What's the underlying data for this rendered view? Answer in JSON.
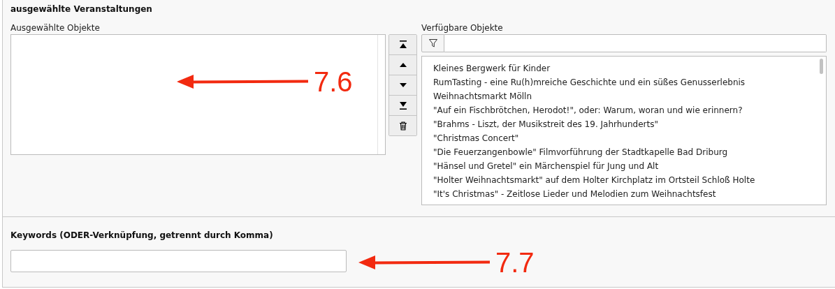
{
  "section_title": "ausgewählte Veranstaltungen",
  "selected_objects": {
    "label": "Ausgewählte Objekte"
  },
  "available_objects": {
    "label": "Verfügbare Objekte",
    "items": [
      "Kleines Bergwerk für Kinder",
      "RumTasting - eine Ru(h)mreiche Geschichte und ein süßes Genusserlebnis",
      "Weihnachtsmarkt Mölln",
      "\"Auf ein Fischbrötchen, Herodot!\", oder: Warum, woran und wie erinnern?",
      "\"Brahms - Liszt, der Musikstreit des 19. Jahrhunderts\"",
      "\"Christmas Concert\"",
      "\"Die Feuerzangenbowle\" Filmvorführung der Stadtkapelle Bad Driburg",
      "\"Hänsel und Gretel\" ein Märchenspiel für Jung und Alt",
      "\"Holter Weihnachtsmarkt\" auf dem Holter Kirchplatz im Ortsteil Schloß Holte",
      "\"It's Christmas\" - Zeitlose Lieder und Melodien zum Weihnachtsfest"
    ]
  },
  "keywords": {
    "label": "Keywords (ODER-Verknüpfung, getrennt durch Komma)"
  },
  "annotations": [
    {
      "label": "7.6"
    },
    {
      "label": "7.7"
    }
  ]
}
